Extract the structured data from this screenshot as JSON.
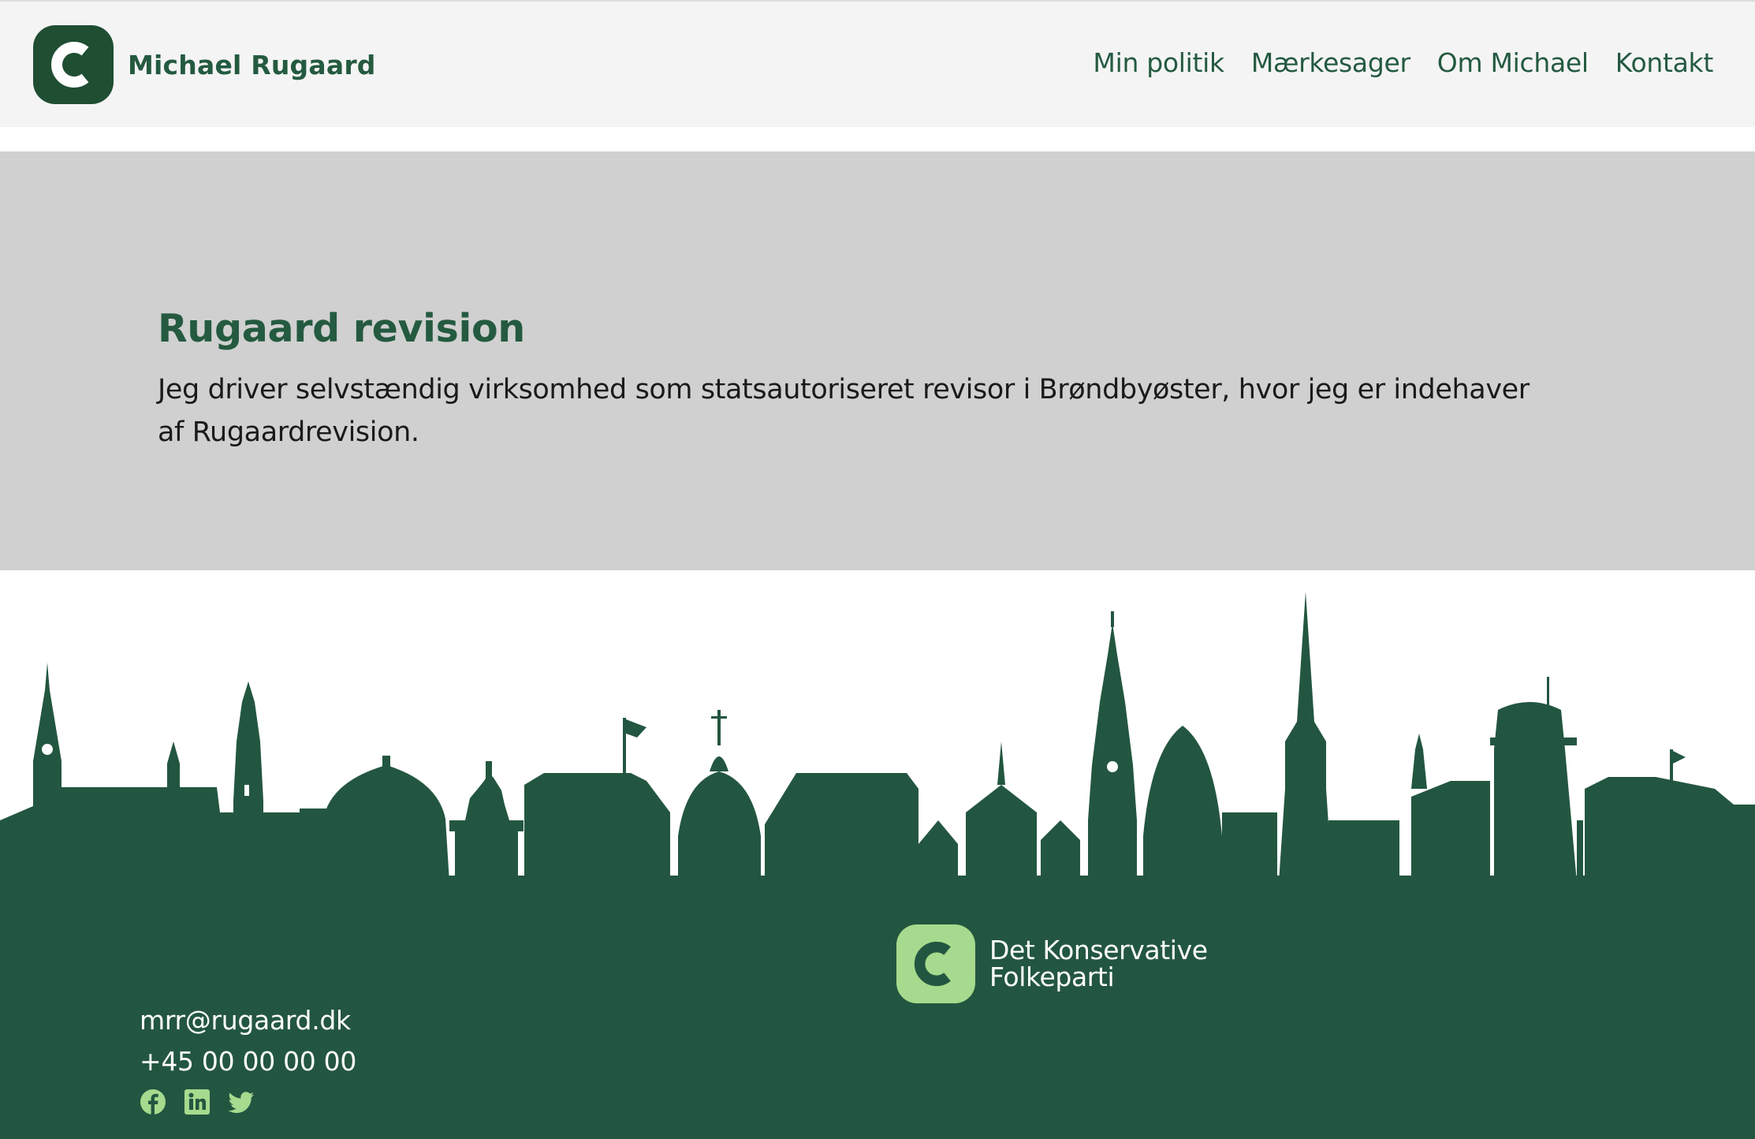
{
  "header": {
    "brand_name": "Michael Rugaard",
    "nav": [
      {
        "label": "Min politik"
      },
      {
        "label": "Mærkesager"
      },
      {
        "label": "Om Michael"
      },
      {
        "label": "Kontakt"
      }
    ]
  },
  "hero": {
    "title": "Rugaard revision",
    "text": "Jeg driver selvstændig virksomhed som statsautoriseret revisor i Brøndbyøster, hvor jeg er indehaver af Rugaardrevision."
  },
  "footer": {
    "email": "mrr@rugaard.dk",
    "phone": "+45 00 00 00 00",
    "socials": [
      "facebook-icon",
      "linkedin-icon",
      "twitter-icon"
    ],
    "party_name_line1": "Det Konservative",
    "party_name_line2": "Folkeparti"
  },
  "colors": {
    "brand_green": "#245a40",
    "footer_green": "#235640",
    "logo_dark": "#1f4e33",
    "logo_light": "#a6da8e",
    "hero_bg": "#d0d0d0",
    "header_bg": "#f4f4f4"
  }
}
